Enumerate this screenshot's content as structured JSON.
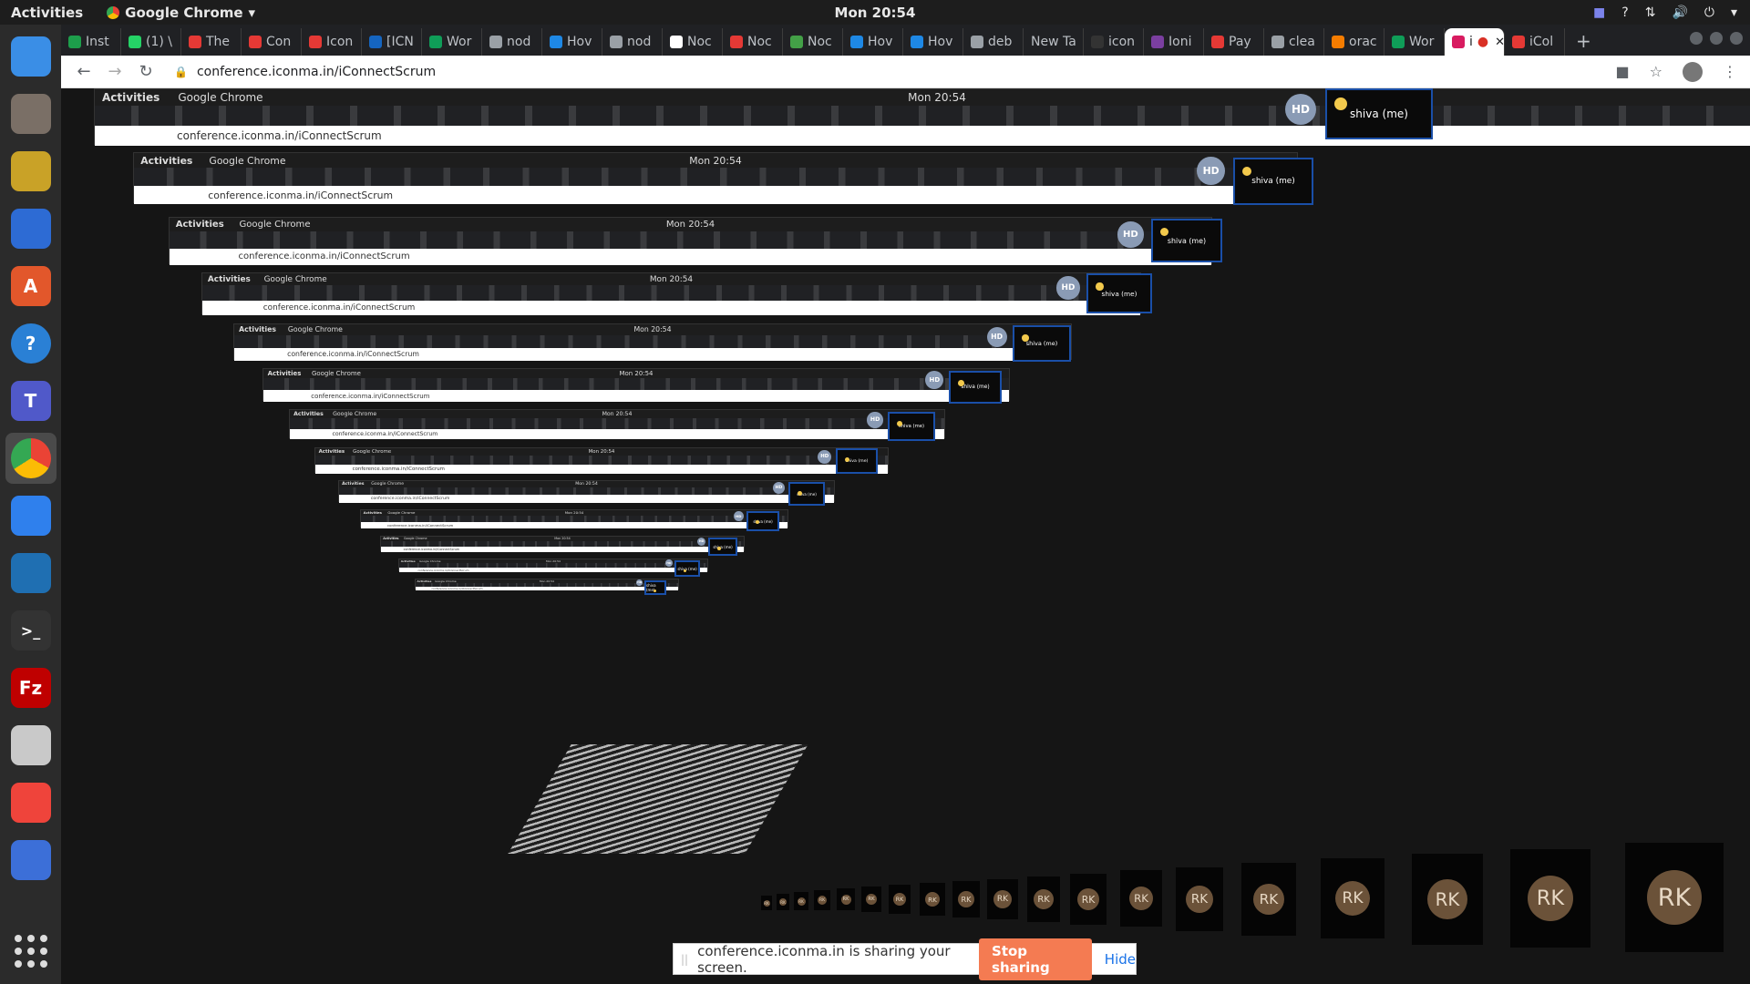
{
  "system_bar": {
    "activities": "Activities",
    "app_name": "Google Chrome",
    "clock": "Mon 20:54"
  },
  "dock": {
    "apps": [
      "thunderbird-icon",
      "files-icon",
      "rhythmbox-icon",
      "writer-icon",
      "software-center-icon",
      "help-icon",
      "teams-icon",
      "chrome-icon",
      "vscode-icon",
      "mysql-workbench-icon",
      "terminal-icon",
      "filezilla-icon",
      "settings-icon",
      "anydesk-icon",
      "remote-desktop-icon"
    ],
    "colors": [
      "#3a8ee6",
      "#7a6f66",
      "#c9a227",
      "#2d6bd4",
      "#e2572b",
      "#2a80d5",
      "#5059c9",
      "#ffffff",
      "#2f80ed",
      "#1f6fb2",
      "#333333",
      "#bf0000",
      "#c9c9c9",
      "#ef443b",
      "#3c6fd8"
    ]
  },
  "browser": {
    "tabs": [
      {
        "label": "Inst",
        "fav": "#1d9e4b"
      },
      {
        "label": "(1) \\",
        "fav": "#25d366"
      },
      {
        "label": "The",
        "fav": "#e53935"
      },
      {
        "label": "Con",
        "fav": "#e53935"
      },
      {
        "label": "Icon",
        "fav": "#e53935"
      },
      {
        "label": "[ICN",
        "fav": "#1565c0"
      },
      {
        "label": "Wor",
        "fav": "#0f9d58"
      },
      {
        "label": "nod",
        "fav": "#9aa0a6"
      },
      {
        "label": "Hov",
        "fav": "#1e88e5"
      },
      {
        "label": "nod",
        "fav": "#9aa0a6"
      },
      {
        "label": "Noc",
        "fav": "#ffffff"
      },
      {
        "label": "Noc",
        "fav": "#e53935"
      },
      {
        "label": "Noc",
        "fav": "#43a047"
      },
      {
        "label": "Hov",
        "fav": "#1e88e5"
      },
      {
        "label": "Hov",
        "fav": "#1e88e5"
      },
      {
        "label": "deb",
        "fav": "#9aa0a6"
      },
      {
        "label": "New Ta",
        "fav": ""
      },
      {
        "label": "icon",
        "fav": "#333333"
      },
      {
        "label": "Ioni",
        "fav": "#7b3fa0"
      },
      {
        "label": "Pay",
        "fav": "#e53935"
      },
      {
        "label": "clea",
        "fav": "#9aa0a6"
      },
      {
        "label": "orac",
        "fav": "#f57c00"
      },
      {
        "label": "Wor",
        "fav": "#0f9d58"
      },
      {
        "label": "i",
        "fav": "#d81b60",
        "active": true
      },
      {
        "label": "iCol",
        "fav": "#e53935"
      }
    ],
    "url": "conference.iconma.in/iConnectScrum",
    "new_tab": "+"
  },
  "conference": {
    "self_name": "shiva (me)",
    "host_initials": "HD",
    "participant_initials": "RK"
  },
  "share_banner": {
    "message": "conference.iconma.in is sharing your screen.",
    "stop": "Stop sharing",
    "hide": "Hide"
  }
}
